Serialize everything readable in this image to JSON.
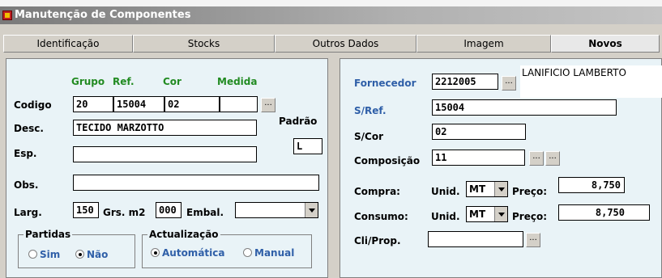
{
  "window": {
    "title": "Manutenção de Componentes"
  },
  "tabs": [
    {
      "label": "Identificação",
      "active": false
    },
    {
      "label": "Stocks",
      "active": false
    },
    {
      "label": "Outros Dados",
      "active": false
    },
    {
      "label": "Imagem",
      "active": false
    },
    {
      "label": "Novos",
      "active": true
    }
  ],
  "left": {
    "headers": {
      "grupo": "Grupo",
      "ref": "Ref.",
      "cor": "Cor",
      "medida": "Medida"
    },
    "codigo": {
      "label": "Codigo",
      "grupo": "20",
      "ref": "15004",
      "cor": "02",
      "medida": ""
    },
    "desc": {
      "label": "Desc.",
      "value": "TECIDO MARZOTTO"
    },
    "padrao": {
      "label": "Padrão",
      "value": "L"
    },
    "esp": {
      "label": "Esp.",
      "value": ""
    },
    "obs": {
      "label": "Obs.",
      "value": ""
    },
    "larg": {
      "label": "Larg.",
      "value": "150",
      "grs_label": "Grs. m2",
      "grs_value": "000",
      "embal_label": "Embal.",
      "embal_value": ""
    },
    "partidas": {
      "legend": "Partidas",
      "sim": "Sim",
      "nao": "Não",
      "selected": "nao"
    },
    "actualizacao": {
      "legend": "Actualização",
      "automatica": "Automática",
      "manual": "Manual",
      "selected": "automatica"
    }
  },
  "right": {
    "fornecedor": {
      "label": "Fornecedor",
      "code": "2212005",
      "name": "LANIFICIO LAMBERTO"
    },
    "sref": {
      "label": "S/Ref.",
      "value": "15004"
    },
    "scor": {
      "label": "S/Cor",
      "value": "02"
    },
    "composicao": {
      "label": "Composição",
      "value": "11"
    },
    "compra": {
      "label": "Compra:",
      "unid_label": "Unid.",
      "unid": "MT",
      "preco_label": "Preço:",
      "preco": "8,750"
    },
    "consumo": {
      "label": "Consumo:",
      "unid_label": "Unid.",
      "unid": "MT",
      "preco_label": "Preço:",
      "preco": "8,750"
    },
    "cliprop": {
      "label": "Cli/Prop.",
      "value": ""
    }
  },
  "ellipsis": "..."
}
